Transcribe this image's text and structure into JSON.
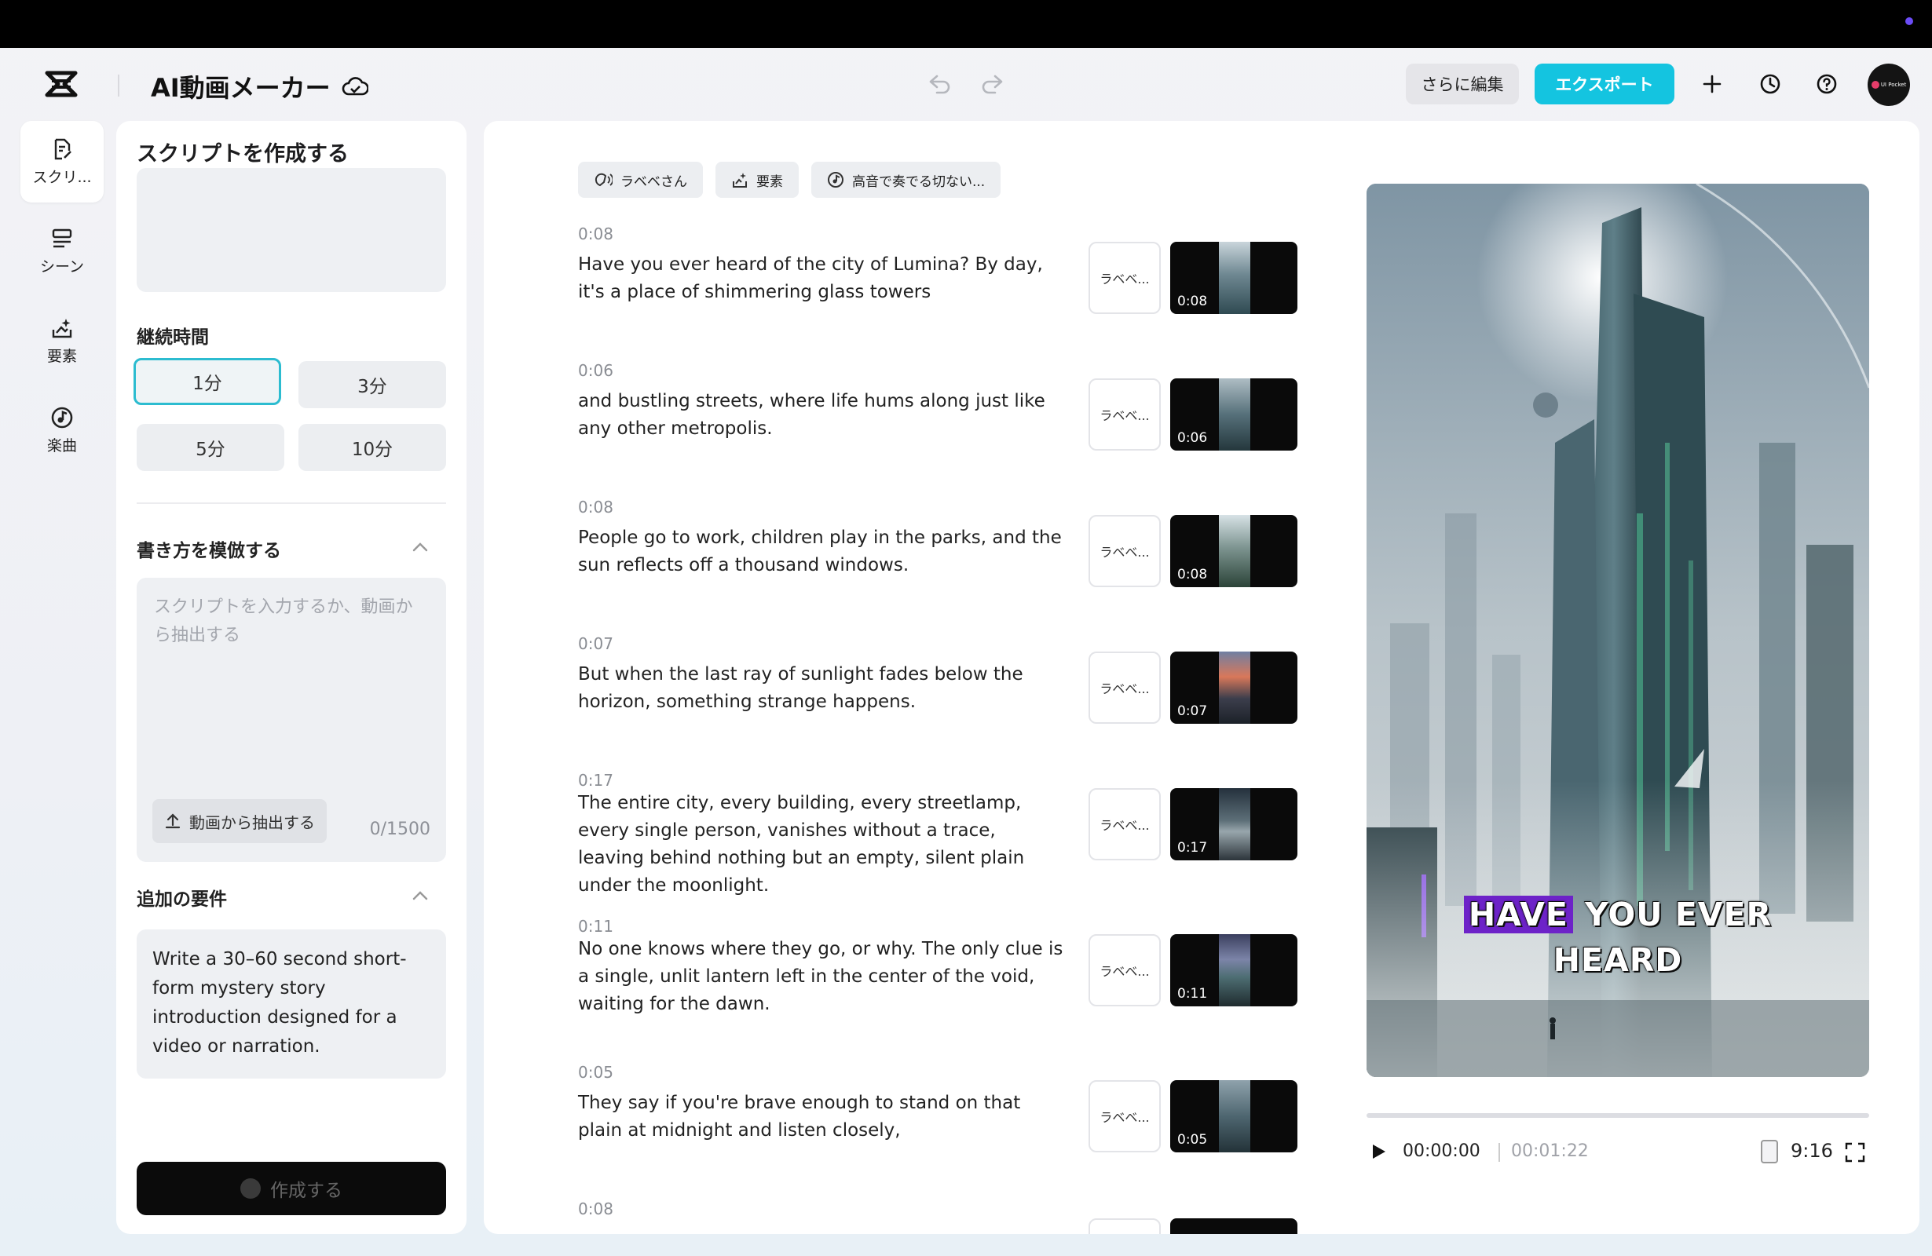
{
  "header": {
    "app_title": "AI動画メーカー",
    "edit_label": "さらに編集",
    "export_label": "エクスポート",
    "avatar_text": "UI Pocket"
  },
  "rail": {
    "items": [
      {
        "label": "スクリ...",
        "icon": "script-icon",
        "active": true
      },
      {
        "label": "シーン",
        "icon": "scenes-icon"
      },
      {
        "label": "要素",
        "icon": "elements-icon"
      },
      {
        "label": "楽曲",
        "icon": "music-icon"
      }
    ]
  },
  "left_panel": {
    "title": "スクリプトを作成する",
    "duration_label": "継続時間",
    "durations": [
      "1分",
      "3分",
      "5分",
      "10分"
    ],
    "selected_duration": "1分",
    "imitate_label": "書き方を模倣する",
    "script_placeholder": "スクリプトを入力するか、動画から抽出する",
    "extract_label": "動画から抽出する",
    "counter": "0/1500",
    "requirements_label": "追加の要件",
    "requirements_text": "Write a 30–60 second short-form mystery story introduction designed for a video or narration.",
    "create_label": "作成する"
  },
  "chips": [
    {
      "label": "ラベベさん",
      "icon": "voice-icon"
    },
    {
      "label": "要素",
      "icon": "elements-icon"
    },
    {
      "label": "高音で奏でる切ない...",
      "icon": "music-icon"
    }
  ],
  "scenes": [
    {
      "time": "0:08",
      "text": "Have you ever heard of the city of Lumina? By day, it's a place of shimmering glass towers",
      "voice": "ラベベ...",
      "duration": "0:08"
    },
    {
      "time": "0:06",
      "text": "and bustling streets, where life hums along just like any other metropolis.",
      "voice": "ラベベ...",
      "duration": "0:06"
    },
    {
      "time": "0:08",
      "text": "People go to work, children play in the parks, and the sun reflects off a thousand windows.",
      "voice": "ラベベ...",
      "duration": "0:08"
    },
    {
      "time": "0:07",
      "text": "But when the last ray of sunlight fades below the horizon, something strange happens.",
      "voice": "ラベベ...",
      "duration": "0:07"
    },
    {
      "time": "0:17",
      "text": "The entire city, every building, every streetlamp, every single person, vanishes without a trace, leaving behind nothing but an empty, silent plain under the moonlight.",
      "voice": "ラベベ...",
      "duration": "0:17"
    },
    {
      "time": "0:11",
      "text": "No one knows where they go, or why. The only clue is a single, unlit lantern left in the center of the void, waiting for the dawn.",
      "voice": "ラベベ...",
      "duration": "0:11"
    },
    {
      "time": "0:05",
      "text": "They say if you're brave enough to stand on that plain at midnight and listen closely,",
      "voice": "ラベベ...",
      "duration": "0:05"
    },
    {
      "time": "0:08",
      "text": "",
      "voice": "",
      "duration": ""
    }
  ],
  "preview": {
    "caption_highlight": "HAVE",
    "caption_rest": "YOU EVER",
    "caption_line2": "HEARD",
    "current_time": "00:00:00",
    "total_time": "00:01:22",
    "aspect_ratio": "9:16",
    "progress_fraction": 0.0
  },
  "colors": {
    "accent": "#14c4e0",
    "selected_border": "#2cbcd0",
    "caption_highlight": "#6d22c8"
  }
}
